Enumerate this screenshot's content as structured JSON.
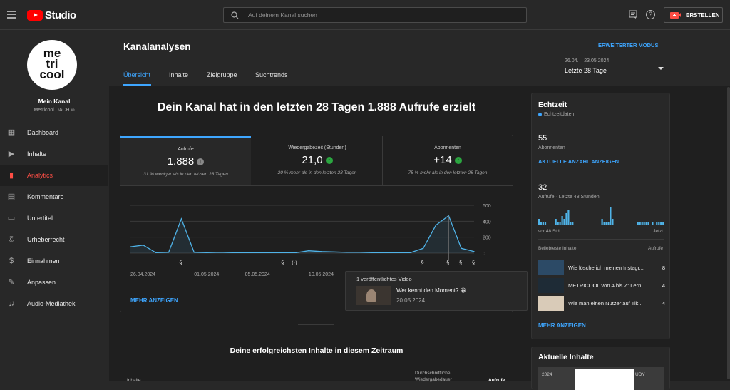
{
  "topbar": {
    "logo_text": "Studio",
    "search_placeholder": "Auf deinem Kanal suchen",
    "create_label": "ERSTELLEN"
  },
  "channel": {
    "avatar_lines": [
      "me",
      "tri",
      "cool"
    ],
    "name": "Mein Kanal",
    "handle": "Metricool DACH ∞"
  },
  "sidebar": {
    "items": [
      {
        "label": "Dashboard",
        "icon": "dashboard-icon"
      },
      {
        "label": "Inhalte",
        "icon": "content-icon"
      },
      {
        "label": "Analytics",
        "icon": "analytics-icon"
      },
      {
        "label": "Kommentare",
        "icon": "comments-icon"
      },
      {
        "label": "Untertitel",
        "icon": "subtitles-icon"
      },
      {
        "label": "Urheberrecht",
        "icon": "copyright-icon"
      },
      {
        "label": "Einnahmen",
        "icon": "earn-icon"
      },
      {
        "label": "Anpassen",
        "icon": "customize-icon"
      },
      {
        "label": "Audio-Mediathek",
        "icon": "audio-library-icon"
      }
    ]
  },
  "page": {
    "title": "Kanalanalysen",
    "advanced_mode": "ERWEITERTER MODUS",
    "tabs": [
      "Übersicht",
      "Inhalte",
      "Zielgruppe",
      "Suchtrends"
    ],
    "date_range": "26.04. – 23.05.2024",
    "date_label": "Letzte 28 Tage"
  },
  "overview": {
    "headline": "Dein Kanal hat in den letzten 28 Tagen 1.888 Aufrufe erzielt",
    "metrics": [
      {
        "title": "Aufrufe",
        "value": "1.888",
        "sub": "31 % weniger als in den letzten 28 Tagen",
        "trend": "neutral"
      },
      {
        "title": "Wiedergabezeit (Stunden)",
        "value": "21,0",
        "sub": "20 % mehr als in den letzten 28 Tagen",
        "trend": "up"
      },
      {
        "title": "Abonnenten",
        "value": "+14",
        "sub": "75 % mehr als in den letzten 28 Tagen",
        "trend": "up"
      }
    ],
    "more_label": "MEHR ANZEIGEN",
    "top_content_title": "Deine erfolgreichsten Inhalte in diesem Zeitraum",
    "table_col_content": "Inhalte",
    "table_col_avg_duration": "Durchschnittliche Wiedergabedauer",
    "table_col_views": "Aufrufe"
  },
  "chart_data": {
    "type": "line",
    "title": "",
    "xlabel": "",
    "ylabel": "",
    "x": [
      "26.04.",
      "27.04.",
      "28.04.",
      "29.04.",
      "30.04.",
      "01.05.",
      "02.05.",
      "03.05.",
      "04.05.",
      "05.05.",
      "06.05.",
      "07.05.",
      "08.05.",
      "09.05.",
      "10.05.",
      "11.05.",
      "12.05.",
      "13.05.",
      "14.05.",
      "15.05.",
      "16.05.",
      "17.05.",
      "18.05.",
      "19.05.",
      "20.05.",
      "21.05.",
      "22.05.",
      "23.05."
    ],
    "values": [
      80,
      100,
      5,
      10,
      430,
      10,
      5,
      10,
      5,
      5,
      5,
      5,
      5,
      5,
      30,
      20,
      15,
      10,
      10,
      5,
      5,
      5,
      5,
      60,
      350,
      470,
      60,
      20
    ],
    "x_tick_labels": [
      "26.04.2024",
      "01.05.2024",
      "05.05.2024",
      "10.05.2024"
    ],
    "y_ticks": [
      0,
      200,
      400,
      600
    ],
    "ylim": [
      0,
      600
    ],
    "grid": true,
    "color": "#4fb3e8"
  },
  "tooltip": {
    "header": "1 veröffentlichtes Video",
    "video_title": "Wer kennt den Moment? 😀",
    "date": "20.05.2024"
  },
  "realtime": {
    "title": "Echtzeit",
    "live_label": "Echtzeitdaten",
    "subs_value": "55",
    "subs_label": "Abonnenten",
    "subs_link": "AKTUELLE ANZAHL ANZEIGEN",
    "views_value": "32",
    "views_label": "Aufrufe · Letzte 48 Stunden",
    "left_label": "vor 48 Std.",
    "right_label": "Jetzt",
    "popular_label": "Beliebteste Inhalte",
    "views_col": "Aufrufe",
    "top_items": [
      {
        "title": "Wie lösche ich meinen Instagr...",
        "views": "8"
      },
      {
        "title": "METRICOOL von A bis Z: Lern...",
        "views": "4"
      },
      {
        "title": "Wie man einen Nutzer auf Tik...",
        "views": "4"
      }
    ],
    "more_label": "MEHR ANZEIGEN",
    "bars": [
      2,
      1,
      1,
      1,
      0,
      0,
      0,
      0,
      2,
      1,
      1,
      3,
      2,
      4,
      5,
      1,
      1,
      0,
      0,
      0,
      0,
      0,
      0,
      0,
      0,
      0,
      0,
      0,
      0,
      0,
      2,
      1,
      1,
      1,
      6,
      2,
      0,
      0,
      0,
      0,
      0,
      0,
      0,
      0,
      0,
      0,
      0,
      1,
      1,
      1,
      1,
      1,
      1,
      0,
      1,
      0,
      1,
      1,
      1,
      1
    ]
  },
  "current_content": {
    "title": "Aktuelle Inhalte",
    "thumb_text_left": "2024",
    "thumb_text_right": "UDY"
  }
}
